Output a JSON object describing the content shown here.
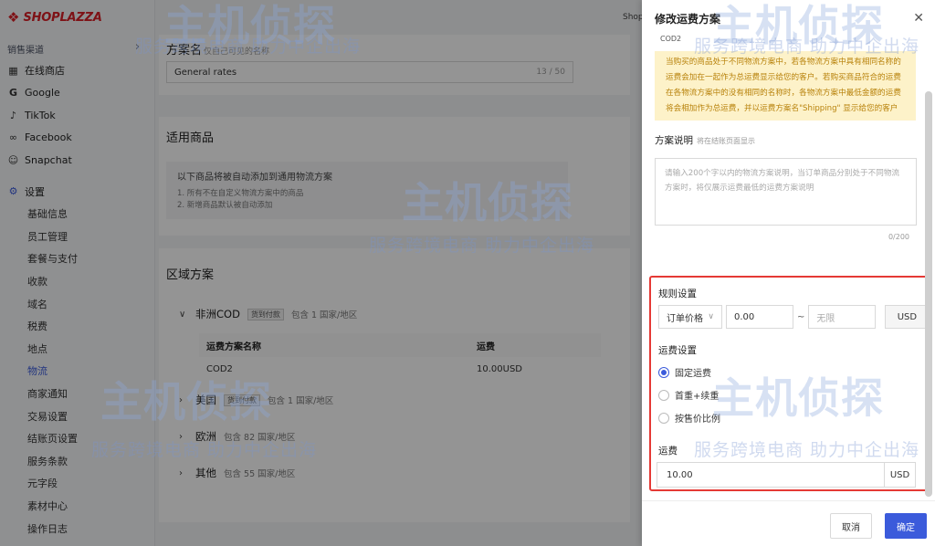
{
  "sidebar": {
    "logo": "SHOPLAZZA",
    "section": "销售渠道",
    "channels": [
      {
        "label": "在线商店",
        "icon": "store-icon"
      },
      {
        "label": "Google",
        "icon": "google-icon"
      },
      {
        "label": "TikTok",
        "icon": "tiktok-icon"
      },
      {
        "label": "Facebook",
        "icon": "facebook-icon"
      },
      {
        "label": "Snapchat",
        "icon": "snapchat-icon"
      }
    ],
    "settings_label": "设置",
    "settings_items": [
      "基础信息",
      "员工管理",
      "套餐与支付",
      "收款",
      "域名",
      "税费",
      "地点",
      "物流",
      "商家通知",
      "交易设置",
      "结账页设置",
      "服务条款",
      "元字段",
      "素材中心",
      "操作日志"
    ]
  },
  "topbar": {
    "shop": "Shop"
  },
  "main": {
    "plan_name_label": "方案名",
    "plan_name_hint": "仅自己可见的名称",
    "plan_name_value": "General rates",
    "plan_name_count": "13 / 50",
    "products_title": "适用商品",
    "products_notice": "以下商品将被自动添加到通用物流方案",
    "products_lines": [
      "1. 所有不在自定义物流方案中的商品",
      "2. 新增商品默认被自动添加"
    ],
    "zones_title": "区域方案",
    "zones": [
      {
        "name": "非洲COD",
        "tag": "货到付款",
        "desc": "包含 1 国家/地区"
      },
      {
        "name": "美国",
        "tag": "货到付款",
        "desc": "包含 1 国家/地区"
      },
      {
        "name": "欧洲",
        "tag": "",
        "desc": "包含 82 国家/地区"
      },
      {
        "name": "其他",
        "tag": "",
        "desc": "包含 55 国家/地区"
      }
    ],
    "table": {
      "col_name": "运费方案名称",
      "col_fee": "运费",
      "rows": [
        {
          "name": "COD2",
          "fee": "10.00USD"
        }
      ]
    }
  },
  "drawer": {
    "title": "修改运费方案",
    "cod_label": "COD2",
    "warning": "当购买的商品处于不同物流方案中，若各物流方案中具有相同名称的运费会加在一起作为总运费显示给您的客户。若购买商品符合的运费在各物流方案中的没有相同的名称时，各物流方案中最低金额的运费将会相加作为总运费，并以运费方案名\"Shipping\" 显示给您的客户",
    "desc_label": "方案说明",
    "desc_hint": "将在结账页面显示",
    "desc_placeholder": "请输入200个字以内的物流方案说明，当订单商品分别处于不同物流方案时，将仅展示运费最低的运费方案说明",
    "desc_count": "0/200",
    "rule_label": "规则设置",
    "rule_select": "订单价格",
    "rule_min": "0.00",
    "rule_max_placeholder": "无限",
    "rule_unit": "USD",
    "fee_setting_label": "运费设置",
    "fee_options": [
      "固定运费",
      "首重+续重",
      "按售价比例"
    ],
    "fee_selected": "固定运费",
    "fee_label": "运费",
    "fee_value": "10.00",
    "fee_unit": "USD",
    "cancel": "取消",
    "confirm": "确定"
  },
  "watermark": {
    "brand": "主机侦探",
    "slogan": "服务跨境电商 助力中企出海"
  },
  "colors": {
    "accent": "#3b5bdb",
    "highlight_border": "#e53935",
    "warning_bg": "#fdf2c9",
    "warning_text": "#b8820b",
    "logo": "#d91f26"
  }
}
